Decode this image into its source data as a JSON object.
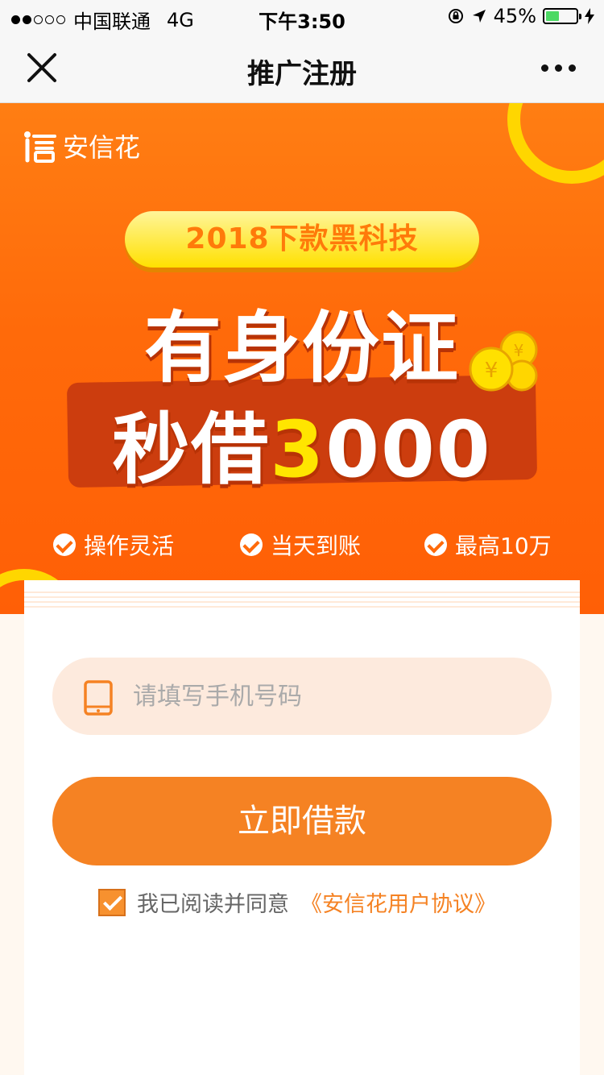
{
  "status_bar": {
    "carrier": "中国联通",
    "network": "4G",
    "time": "下午3:50",
    "battery": "45%",
    "battery_level": 0.45,
    "battery_color": "#4cd964"
  },
  "nav": {
    "title": "推广注册",
    "close_icon": "close-icon",
    "more_icon": "more-icon"
  },
  "banner": {
    "brand": "安信花",
    "tagline": "2018下款黑科技",
    "headline_line1": "有身份证",
    "headline_line2_prefix": "秒借",
    "headline_line2_digit": "3",
    "headline_line2_suffix": "000",
    "features": [
      "操作灵活",
      "当天到账",
      "最高10万"
    ],
    "colors": {
      "primary": "#ff6a0a",
      "accent": "#ffe000"
    }
  },
  "form": {
    "phone_placeholder": "请填写手机号码",
    "phone_value": "",
    "submit_label": "立即借款",
    "agree_text": "我已阅读并同意",
    "agree_link": "《安信花用户协议》",
    "agree_checked": true
  }
}
